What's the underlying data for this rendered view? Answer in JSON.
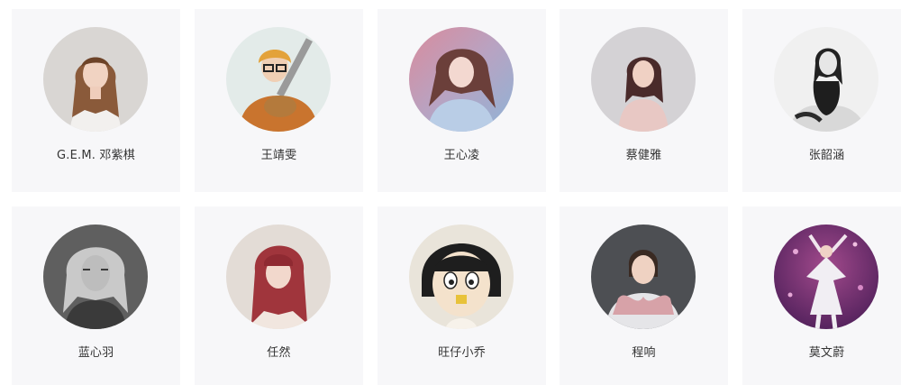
{
  "artists": [
    {
      "name": "G.E.M. 邓紫棋"
    },
    {
      "name": "王靖雯"
    },
    {
      "name": "王心凌"
    },
    {
      "name": "蔡健雅"
    },
    {
      "name": "张韶涵"
    },
    {
      "name": "蓝心羽"
    },
    {
      "name": "任然"
    },
    {
      "name": "旺仔小乔"
    },
    {
      "name": "程响"
    },
    {
      "name": "莫文蔚"
    }
  ],
  "colors": {
    "card_background": "#f7f7f9",
    "name_text": "#333333"
  }
}
